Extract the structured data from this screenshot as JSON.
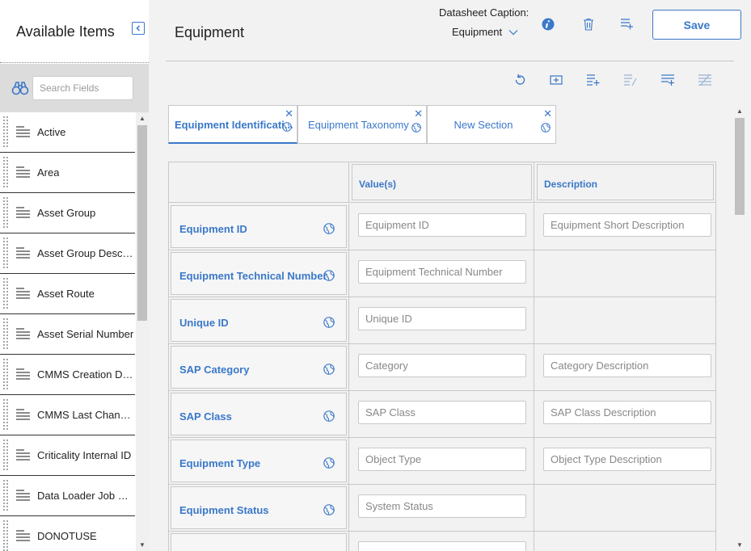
{
  "sidebar": {
    "title": "Available Items",
    "search_placeholder": "Search Fields",
    "items": [
      {
        "label": "Active"
      },
      {
        "label": "Area"
      },
      {
        "label": "Asset Group"
      },
      {
        "label": "Asset Group Descript..."
      },
      {
        "label": "Asset Route"
      },
      {
        "label": "Asset Serial Number"
      },
      {
        "label": "CMMS Creation Date"
      },
      {
        "label": "CMMS Last Changed ..."
      },
      {
        "label": "Criticality Internal ID"
      },
      {
        "label": "Data Loader Job GUID"
      },
      {
        "label": "DONOTUSE"
      }
    ]
  },
  "header": {
    "title": "Equipment",
    "caption_label": "Datasheet Caption:",
    "caption_value": "Equipment",
    "save_label": "Save"
  },
  "tabs": [
    {
      "label": "Equipment Identificati..."
    },
    {
      "label": "Equipment Taxonomy"
    },
    {
      "label": "New Section"
    }
  ],
  "grid": {
    "col_values": "Value(s)",
    "col_description": "Description",
    "rows": [
      {
        "field": "Equipment ID",
        "value_placeholder": "Equipment ID",
        "desc_placeholder": "Equipment Short Description"
      },
      {
        "field": "Equipment Technical Number",
        "value_placeholder": "Equipment Technical Number",
        "desc_placeholder": null
      },
      {
        "field": "Unique ID",
        "value_placeholder": "Unique ID",
        "desc_placeholder": null
      },
      {
        "field": "SAP Category",
        "value_placeholder": "Category",
        "desc_placeholder": "Category Description"
      },
      {
        "field": "SAP Class",
        "value_placeholder": "SAP Class",
        "desc_placeholder": "SAP Class Description"
      },
      {
        "field": "Equipment Type",
        "value_placeholder": "Object Type",
        "desc_placeholder": "Object Type Description"
      },
      {
        "field": "Equipment Status",
        "value_placeholder": "System Status",
        "desc_placeholder": null
      }
    ]
  },
  "colors": {
    "accent": "#3a78c9"
  }
}
